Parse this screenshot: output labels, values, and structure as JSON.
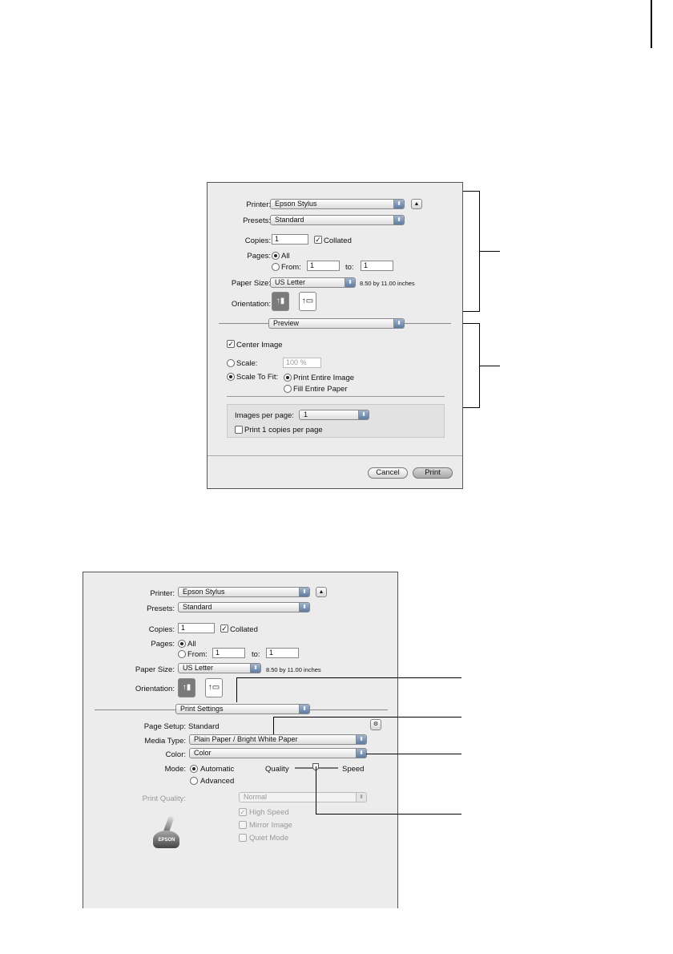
{
  "d1": {
    "printer_label": "Printer:",
    "printer_value": "Epson Stylus",
    "presets_label": "Presets:",
    "presets_value": "Standard",
    "copies_label": "Copies:",
    "copies_value": "1",
    "collated_label": "Collated",
    "pages_label": "Pages:",
    "all_label": "All",
    "from_label": "From:",
    "from_value": "1",
    "to_label": "to:",
    "to_value": "1",
    "paper_size_label": "Paper Size:",
    "paper_size_value": "US Letter",
    "paper_size_info": "8.50 by 11.00 inches",
    "orientation_label": "Orientation:",
    "panel_value": "Preview",
    "center_image_label": "Center Image",
    "scale_label": "Scale:",
    "scale_value": "100 %",
    "scale_to_fit_label": "Scale To Fit:",
    "print_entire_image_label": "Print Entire Image",
    "fill_entire_paper_label": "Fill Entire Paper",
    "images_per_page_label": "Images per page:",
    "images_per_page_value": "1",
    "print_copies_label": "Print 1 copies per page",
    "cancel_label": "Cancel",
    "print_label": "Print"
  },
  "d2": {
    "printer_label": "Printer:",
    "printer_value": "Epson Stylus",
    "presets_label": "Presets:",
    "presets_value": "Standard",
    "copies_label": "Copies:",
    "copies_value": "1",
    "collated_label": "Collated",
    "pages_label": "Pages:",
    "all_label": "All",
    "from_label": "From:",
    "from_value": "1",
    "to_label": "to:",
    "to_value": "1",
    "paper_size_label": "Paper Size:",
    "paper_size_value": "US Letter",
    "paper_size_info": "8.50 by 11.00 inches",
    "orientation_label": "Orientation:",
    "panel_value": "Print Settings",
    "page_setup_label": "Page Setup:",
    "page_setup_value": "Standard",
    "media_type_label": "Media Type:",
    "media_type_value": "Plain Paper / Bright White Paper",
    "color_label": "Color:",
    "color_value": "Color",
    "mode_label": "Mode:",
    "automatic_label": "Automatic",
    "advanced_label": "Advanced",
    "quality_label": "Quality",
    "speed_label": "Speed",
    "print_quality_label": "Print Quality:",
    "print_quality_value": "Normal",
    "high_speed_label": "High Speed",
    "mirror_image_label": "Mirror Image",
    "quiet_mode_label": "Quiet Mode",
    "logo_text": "EPSON"
  },
  "icons": {
    "expand": "triangle-up-icon",
    "popup_arrow": "up-down-arrows-icon",
    "portrait": "portrait-orientation-icon",
    "landscape": "landscape-orientation-icon",
    "page_setup": "page-setup-icon",
    "logo": "epson-printer-logo"
  }
}
